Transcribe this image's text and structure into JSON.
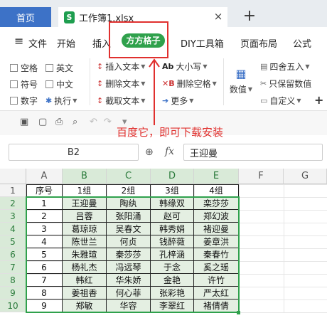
{
  "tabs": {
    "home": "首页",
    "workbook": "工作簿1.xlsx",
    "close": "×",
    "new": "+"
  },
  "menu": {
    "hamburger": "≡",
    "file": "文件",
    "start": "开始",
    "insert": "插入",
    "fangfang": "方方格子",
    "diy": "DIY工具箱",
    "page_layout": "页面布局",
    "formula": "公式"
  },
  "ribbon": {
    "space": "空格",
    "english": "英文",
    "symbol": "符号",
    "chinese": "中文",
    "number": "数字",
    "execute": "执行",
    "insert_text": "插入文本",
    "delete_text": "删除文本",
    "extract_text": "截取文本",
    "case": "大小写",
    "delete_space": "删除空格",
    "more": "更多",
    "numeric": "数值",
    "round": "四舍五入",
    "keep_value": "只保留数值",
    "custom": "自定义",
    "plus": "+"
  },
  "annotation": "百度它，即可下载安装",
  "formula_bar": {
    "cell_ref": "B2",
    "fx": "fx",
    "value": "王迎曼"
  },
  "sheet": {
    "columns": [
      "A",
      "B",
      "C",
      "D",
      "E",
      "F",
      "G"
    ],
    "rows": [
      "1",
      "2",
      "3",
      "4",
      "5",
      "6",
      "7",
      "8",
      "9",
      "10"
    ],
    "header": [
      "序号",
      "1组",
      "2组",
      "3组",
      "4组"
    ],
    "data": [
      [
        "1",
        "王迎曼",
        "陶纨",
        "韩缘双",
        "栾莎莎"
      ],
      [
        "2",
        "吕蓉",
        "张阳涌",
        "赵可",
        "郑幻波"
      ],
      [
        "3",
        "葛琼琼",
        "吴春文",
        "韩秀娟",
        "褚迎曼"
      ],
      [
        "4",
        "陈世兰",
        "何贞",
        "钱醉薇",
        "姜章洪"
      ],
      [
        "5",
        "朱雅瑄",
        "秦莎莎",
        "孔梓涵",
        "秦春竹"
      ],
      [
        "6",
        "杨礼杰",
        "冯远琴",
        "于念",
        "奚之瑶"
      ],
      [
        "7",
        "韩红",
        "华朱娇",
        "金艳",
        "许竹"
      ],
      [
        "8",
        "姜祖香",
        "何心菲",
        "张彩艳",
        "严太红"
      ],
      [
        "9",
        "郑敏",
        "华容",
        "李翠红",
        "褚倩倩"
      ]
    ]
  },
  "colors": {
    "accent_green": "#2fa14c",
    "tab_blue": "#3d72c7",
    "highlight_red": "#e0302e"
  }
}
